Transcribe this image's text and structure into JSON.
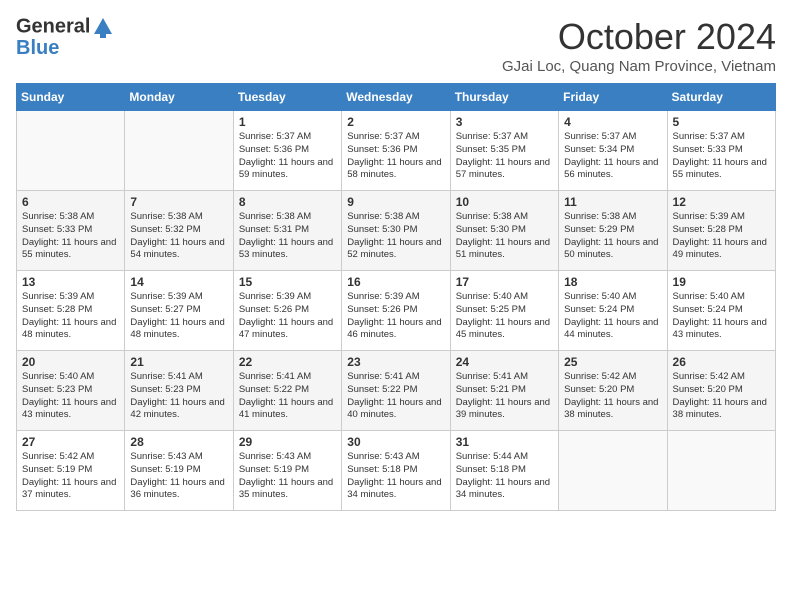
{
  "header": {
    "logo_line1": "General",
    "logo_line2": "Blue",
    "month": "October 2024",
    "location": "GJai Loc, Quang Nam Province, Vietnam"
  },
  "weekdays": [
    "Sunday",
    "Monday",
    "Tuesday",
    "Wednesday",
    "Thursday",
    "Friday",
    "Saturday"
  ],
  "weeks": [
    [
      {
        "day": "",
        "content": ""
      },
      {
        "day": "",
        "content": ""
      },
      {
        "day": "1",
        "content": "Sunrise: 5:37 AM\nSunset: 5:36 PM\nDaylight: 11 hours and 59 minutes."
      },
      {
        "day": "2",
        "content": "Sunrise: 5:37 AM\nSunset: 5:36 PM\nDaylight: 11 hours and 58 minutes."
      },
      {
        "day": "3",
        "content": "Sunrise: 5:37 AM\nSunset: 5:35 PM\nDaylight: 11 hours and 57 minutes."
      },
      {
        "day": "4",
        "content": "Sunrise: 5:37 AM\nSunset: 5:34 PM\nDaylight: 11 hours and 56 minutes."
      },
      {
        "day": "5",
        "content": "Sunrise: 5:37 AM\nSunset: 5:33 PM\nDaylight: 11 hours and 55 minutes."
      }
    ],
    [
      {
        "day": "6",
        "content": "Sunrise: 5:38 AM\nSunset: 5:33 PM\nDaylight: 11 hours and 55 minutes."
      },
      {
        "day": "7",
        "content": "Sunrise: 5:38 AM\nSunset: 5:32 PM\nDaylight: 11 hours and 54 minutes."
      },
      {
        "day": "8",
        "content": "Sunrise: 5:38 AM\nSunset: 5:31 PM\nDaylight: 11 hours and 53 minutes."
      },
      {
        "day": "9",
        "content": "Sunrise: 5:38 AM\nSunset: 5:30 PM\nDaylight: 11 hours and 52 minutes."
      },
      {
        "day": "10",
        "content": "Sunrise: 5:38 AM\nSunset: 5:30 PM\nDaylight: 11 hours and 51 minutes."
      },
      {
        "day": "11",
        "content": "Sunrise: 5:38 AM\nSunset: 5:29 PM\nDaylight: 11 hours and 50 minutes."
      },
      {
        "day": "12",
        "content": "Sunrise: 5:39 AM\nSunset: 5:28 PM\nDaylight: 11 hours and 49 minutes."
      }
    ],
    [
      {
        "day": "13",
        "content": "Sunrise: 5:39 AM\nSunset: 5:28 PM\nDaylight: 11 hours and 48 minutes."
      },
      {
        "day": "14",
        "content": "Sunrise: 5:39 AM\nSunset: 5:27 PM\nDaylight: 11 hours and 48 minutes."
      },
      {
        "day": "15",
        "content": "Sunrise: 5:39 AM\nSunset: 5:26 PM\nDaylight: 11 hours and 47 minutes."
      },
      {
        "day": "16",
        "content": "Sunrise: 5:39 AM\nSunset: 5:26 PM\nDaylight: 11 hours and 46 minutes."
      },
      {
        "day": "17",
        "content": "Sunrise: 5:40 AM\nSunset: 5:25 PM\nDaylight: 11 hours and 45 minutes."
      },
      {
        "day": "18",
        "content": "Sunrise: 5:40 AM\nSunset: 5:24 PM\nDaylight: 11 hours and 44 minutes."
      },
      {
        "day": "19",
        "content": "Sunrise: 5:40 AM\nSunset: 5:24 PM\nDaylight: 11 hours and 43 minutes."
      }
    ],
    [
      {
        "day": "20",
        "content": "Sunrise: 5:40 AM\nSunset: 5:23 PM\nDaylight: 11 hours and 43 minutes."
      },
      {
        "day": "21",
        "content": "Sunrise: 5:41 AM\nSunset: 5:23 PM\nDaylight: 11 hours and 42 minutes."
      },
      {
        "day": "22",
        "content": "Sunrise: 5:41 AM\nSunset: 5:22 PM\nDaylight: 11 hours and 41 minutes."
      },
      {
        "day": "23",
        "content": "Sunrise: 5:41 AM\nSunset: 5:22 PM\nDaylight: 11 hours and 40 minutes."
      },
      {
        "day": "24",
        "content": "Sunrise: 5:41 AM\nSunset: 5:21 PM\nDaylight: 11 hours and 39 minutes."
      },
      {
        "day": "25",
        "content": "Sunrise: 5:42 AM\nSunset: 5:20 PM\nDaylight: 11 hours and 38 minutes."
      },
      {
        "day": "26",
        "content": "Sunrise: 5:42 AM\nSunset: 5:20 PM\nDaylight: 11 hours and 38 minutes."
      }
    ],
    [
      {
        "day": "27",
        "content": "Sunrise: 5:42 AM\nSunset: 5:19 PM\nDaylight: 11 hours and 37 minutes."
      },
      {
        "day": "28",
        "content": "Sunrise: 5:43 AM\nSunset: 5:19 PM\nDaylight: 11 hours and 36 minutes."
      },
      {
        "day": "29",
        "content": "Sunrise: 5:43 AM\nSunset: 5:19 PM\nDaylight: 11 hours and 35 minutes."
      },
      {
        "day": "30",
        "content": "Sunrise: 5:43 AM\nSunset: 5:18 PM\nDaylight: 11 hours and 34 minutes."
      },
      {
        "day": "31",
        "content": "Sunrise: 5:44 AM\nSunset: 5:18 PM\nDaylight: 11 hours and 34 minutes."
      },
      {
        "day": "",
        "content": ""
      },
      {
        "day": "",
        "content": ""
      }
    ]
  ]
}
